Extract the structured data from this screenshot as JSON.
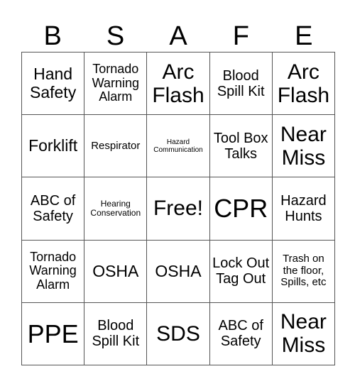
{
  "header": {
    "letters": [
      "B",
      "S",
      "A",
      "F",
      "E"
    ]
  },
  "cells": [
    "Hand Safety",
    "Tornado Warning Alarm",
    "Arc Flash",
    "Blood Spill Kit",
    "Arc Flash",
    "Forklift",
    "Respirator",
    "Hazard Communication",
    "Tool Box Talks",
    "Near Miss",
    "ABC of Safety",
    "Hearing Conservation",
    "Free!",
    "CPR",
    "Hazard Hunts",
    "Tornado Warning Alarm",
    "OSHA",
    "OSHA",
    "Lock Out Tag Out",
    "Trash on the floor, Spills, etc",
    "PPE",
    "Blood Spill Kit",
    "SDS",
    "ABC of Safety",
    "Near Miss"
  ]
}
